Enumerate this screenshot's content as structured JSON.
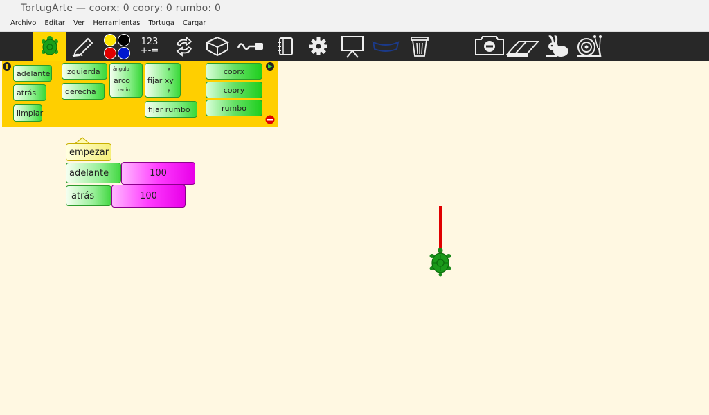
{
  "window": {
    "title": "TortugArte — coorx: 0 coory: 0 rumbo: 0"
  },
  "menu": [
    "Archivo",
    "Editar",
    "Ver",
    "Herramientas",
    "Tortuga",
    "Cargar"
  ],
  "toolbar": {
    "numbers_line1": "123",
    "numbers_line2": "+-=",
    "icons": [
      "turtle-icon",
      "pen-icon",
      "colors-icon",
      "numbers-icon",
      "flow-icon",
      "blocks-icon",
      "sensor-icon",
      "notebook-icon",
      "gear-icon",
      "presentation-icon",
      "extras-icon",
      "trash-icon",
      "hide-palette-icon",
      "eraser-icon",
      "rabbit-icon",
      "snail-icon"
    ]
  },
  "palette": {
    "forward": "adelante",
    "back": "atrás",
    "clean": "limpiar",
    "left": "izquierda",
    "right": "derecha",
    "arc_angle": "ángulo",
    "arc": "arco",
    "arc_radius": "radio",
    "setxy": "fijar xy",
    "setxy_x": "x",
    "setxy_y": "y",
    "setheading": "fijar rumbo",
    "xcor": "coorx",
    "ycor": "coory",
    "heading": "rumbo"
  },
  "program": {
    "start": "empezar",
    "forward": "adelante",
    "forward_value": "100",
    "back": "atrás",
    "back_value": "100"
  },
  "colors": {
    "toolbar_bg": "#282828",
    "palette_bg": "#ffcf00",
    "canvas_bg": "#fff8e2",
    "pen": "#e00000",
    "turtle": "#1a8a1a"
  }
}
